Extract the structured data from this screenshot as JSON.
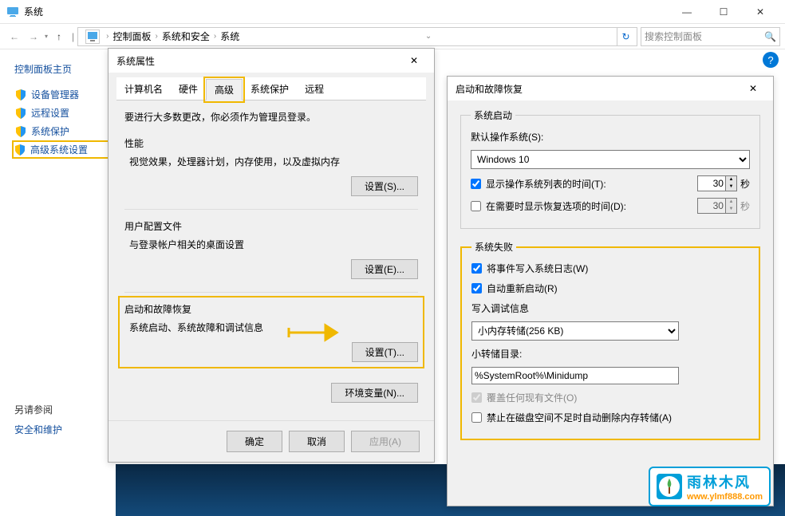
{
  "window": {
    "title": "系统",
    "min": "—",
    "max": "☐",
    "close": "✕"
  },
  "nav": {
    "back": "←",
    "forward": "→",
    "up": "↑",
    "breadcrumb": [
      "控制面板",
      "系统和安全",
      "系统"
    ],
    "search_placeholder": "搜索控制面板",
    "refresh": "↻",
    "help": "?"
  },
  "sidebar": {
    "head": "控制面板主页",
    "items": [
      {
        "label": "设备管理器"
      },
      {
        "label": "远程设置"
      },
      {
        "label": "系统保护"
      },
      {
        "label": "高级系统设置"
      }
    ],
    "footer_head": "另请参阅",
    "footer_link": "安全和维护"
  },
  "sysprops": {
    "title": "系统属性",
    "close": "✕",
    "tabs": [
      "计算机名",
      "硬件",
      "高级",
      "系统保护",
      "远程"
    ],
    "admin_note": "要进行大多数更改，你必须作为管理员登录。",
    "perf": {
      "title": "性能",
      "desc": "视觉效果，处理器计划，内存使用，以及虚拟内存",
      "btn": "设置(S)..."
    },
    "profile": {
      "title": "用户配置文件",
      "desc": "与登录帐户相关的桌面设置",
      "btn": "设置(E)..."
    },
    "startup": {
      "title": "启动和故障恢复",
      "desc": "系统启动、系统故障和调试信息",
      "btn": "设置(T)..."
    },
    "env_btn": "环境变量(N)...",
    "ok": "确定",
    "cancel": "取消",
    "apply": "应用(A)"
  },
  "recovery": {
    "title": "启动和故障恢复",
    "close": "✕",
    "sys_startup": {
      "legend": "系统启动",
      "default_os_label": "默认操作系统(S):",
      "default_os": "Windows 10",
      "show_time_label": "显示操作系统列表的时间(T):",
      "show_time_val": "30",
      "recovery_time_label": "在需要时显示恢复选项的时间(D):",
      "recovery_time_val": "30",
      "unit": "秒"
    },
    "sys_failure": {
      "legend": "系统失败",
      "write_log": "将事件写入系统日志(W)",
      "auto_restart": "自动重新启动(R)",
      "debug_info_label": "写入调试信息",
      "debug_dump": "小内存转储(256 KB)",
      "dump_dir_label": "小转储目录:",
      "dump_dir": "%SystemRoot%\\Minidump",
      "overwrite": "覆盖任何现有文件(O)",
      "no_delete": "禁止在磁盘空间不足时自动删除内存转储(A)"
    }
  },
  "watermark": {
    "title": "雨林木风",
    "url": "www.ylmf888.com"
  }
}
